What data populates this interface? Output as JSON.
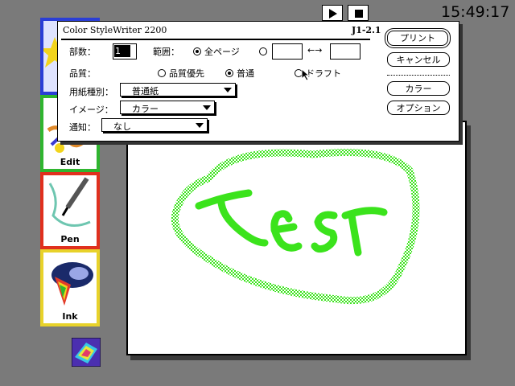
{
  "clock": "15:49:17",
  "media": {
    "play": "play-icon",
    "stop": "stop-icon"
  },
  "tools": {
    "edit": {
      "label": "Edit",
      "color": "#2fb52f"
    },
    "pen": {
      "label": "Pen",
      "color": "#e0301e"
    },
    "ink": {
      "label": "Ink",
      "color": "#e8d22a"
    },
    "top": {
      "color": "#2a3ed6"
    }
  },
  "canvas": {
    "ink_color": "#3be31c",
    "handwriting_icon": "handwritten-test-text"
  },
  "dialog": {
    "title": "Color StyleWriter 2200",
    "version": "J1-2.1",
    "copies_label": "部数：",
    "copies_value": "1",
    "range_label": "範囲：",
    "all_pages": "全ページ",
    "range_arrow": "←→",
    "quality_label": "品質：",
    "quality_best": "品質優先",
    "quality_normal": "普通",
    "quality_draft": "ドラフト",
    "paper_label": "用紙種別：",
    "paper_value": "普通紙",
    "image_label": "イメージ：",
    "image_value": "カラー",
    "notify_label": "通知：",
    "notify_value": "なし",
    "buttons": {
      "print": "プリント",
      "cancel": "キャンセル",
      "color": "カラー",
      "options": "オプション"
    }
  }
}
